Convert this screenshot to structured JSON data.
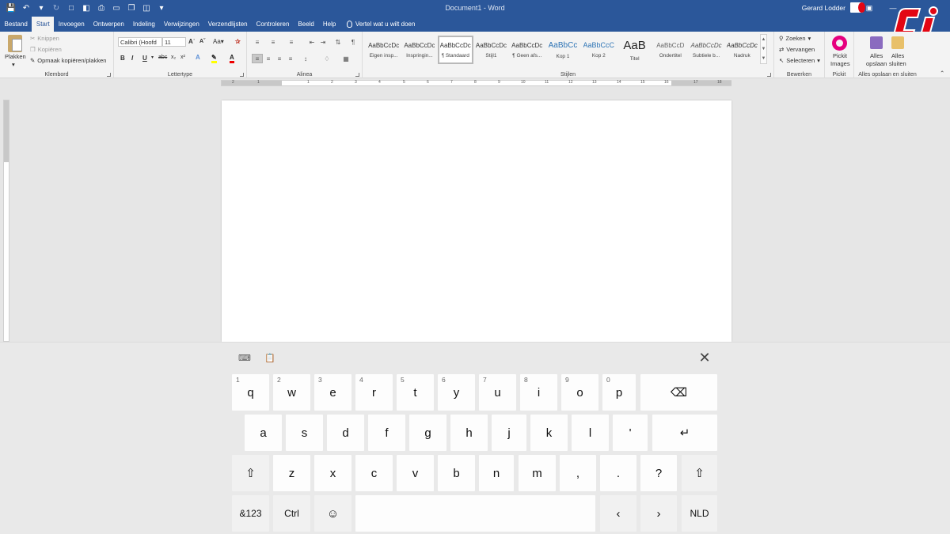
{
  "window": {
    "title": "Document1 - Word",
    "user": "Gerard Lodder"
  },
  "tabs": [
    {
      "label": "Bestand"
    },
    {
      "label": "Start"
    },
    {
      "label": "Invoegen"
    },
    {
      "label": "Ontwerpen"
    },
    {
      "label": "Indeling"
    },
    {
      "label": "Verwijzingen"
    },
    {
      "label": "Verzendlijsten"
    },
    {
      "label": "Controleren"
    },
    {
      "label": "Beeld"
    },
    {
      "label": "Help"
    }
  ],
  "tell_me": "Vertel wat u wilt doen",
  "ribbon": {
    "clipboard": {
      "group_label": "Klembord",
      "paste": "Plakken",
      "cut": "Knippen",
      "copy": "Kopiëren",
      "format_painter": "Opmaak kopiëren/plakken"
    },
    "font": {
      "group_label": "Lettertype",
      "font_name": "Calibri (Hoofd",
      "font_size": "11"
    },
    "paragraph": {
      "group_label": "Alinea"
    },
    "styles": {
      "group_label": "Stijlen",
      "items": [
        {
          "sample": "AaBbCcDc",
          "name": "Eigen insp..."
        },
        {
          "sample": "AaBbCcDc",
          "name": "Inspringin..."
        },
        {
          "sample": "AaBbCcDc",
          "name": "¶ Standaard"
        },
        {
          "sample": "AaBbCcDc",
          "name": "Stijl1"
        },
        {
          "sample": "AaBbCcDc",
          "name": "¶ Geen afs..."
        },
        {
          "sample": "AaBbCc",
          "name": "Kop 1"
        },
        {
          "sample": "AaBbCcC",
          "name": "Kop 2"
        },
        {
          "sample": "AaB",
          "name": "Titel"
        },
        {
          "sample": "AaBbCcD",
          "name": "Ondertitel"
        },
        {
          "sample": "AaBbCcDc",
          "name": "Subtiele b..."
        },
        {
          "sample": "AaBbCcDc",
          "name": "Nadruk"
        }
      ]
    },
    "editing": {
      "group_label": "Bewerken",
      "find": "Zoeken",
      "replace": "Vervangen",
      "select": "Selecteren"
    },
    "pickit": {
      "group_label": "Pickit",
      "button": "Pickit",
      "button2": "Images"
    },
    "save_close": {
      "group_label": "Alles opslaan en sluiten",
      "save_all": "Alles",
      "save_all2": "opslaan",
      "close_all": "Alles",
      "close_all2": "sluiten"
    }
  },
  "ruler": {
    "labels": [
      "2",
      "1",
      "1",
      "2",
      "3",
      "4",
      "5",
      "6",
      "7",
      "8",
      "9",
      "10",
      "11",
      "12",
      "13",
      "14",
      "15",
      "16",
      "17",
      "18"
    ]
  },
  "keyboard": {
    "row1": [
      {
        "label": "q",
        "hint": "1"
      },
      {
        "label": "w",
        "hint": "2"
      },
      {
        "label": "e",
        "hint": "3"
      },
      {
        "label": "r",
        "hint": "4"
      },
      {
        "label": "t",
        "hint": "5"
      },
      {
        "label": "y",
        "hint": "6"
      },
      {
        "label": "u",
        "hint": "7"
      },
      {
        "label": "i",
        "hint": "8"
      },
      {
        "label": "o",
        "hint": "9"
      },
      {
        "label": "p",
        "hint": "0"
      }
    ],
    "row2": [
      "a",
      "s",
      "d",
      "f",
      "g",
      "h",
      "j",
      "k",
      "l",
      "'"
    ],
    "row3": [
      "z",
      "x",
      "c",
      "v",
      "b",
      "n",
      "m",
      ",",
      ".",
      "?"
    ],
    "sym": "&123",
    "ctrl": "Ctrl",
    "lang": "NLD",
    "backspace_glyph": "⌫",
    "enter_glyph": "↵",
    "shift_glyph": "⇧",
    "left_glyph": "‹",
    "right_glyph": "›",
    "emoji_glyph": "☺",
    "close_glyph": "✕"
  },
  "colors": {
    "word_blue": "#2b579a",
    "ribbon_bg": "#f3f3f3",
    "canvas_bg": "#e6e6e6",
    "keyboard_bg": "#e9e9e9"
  }
}
